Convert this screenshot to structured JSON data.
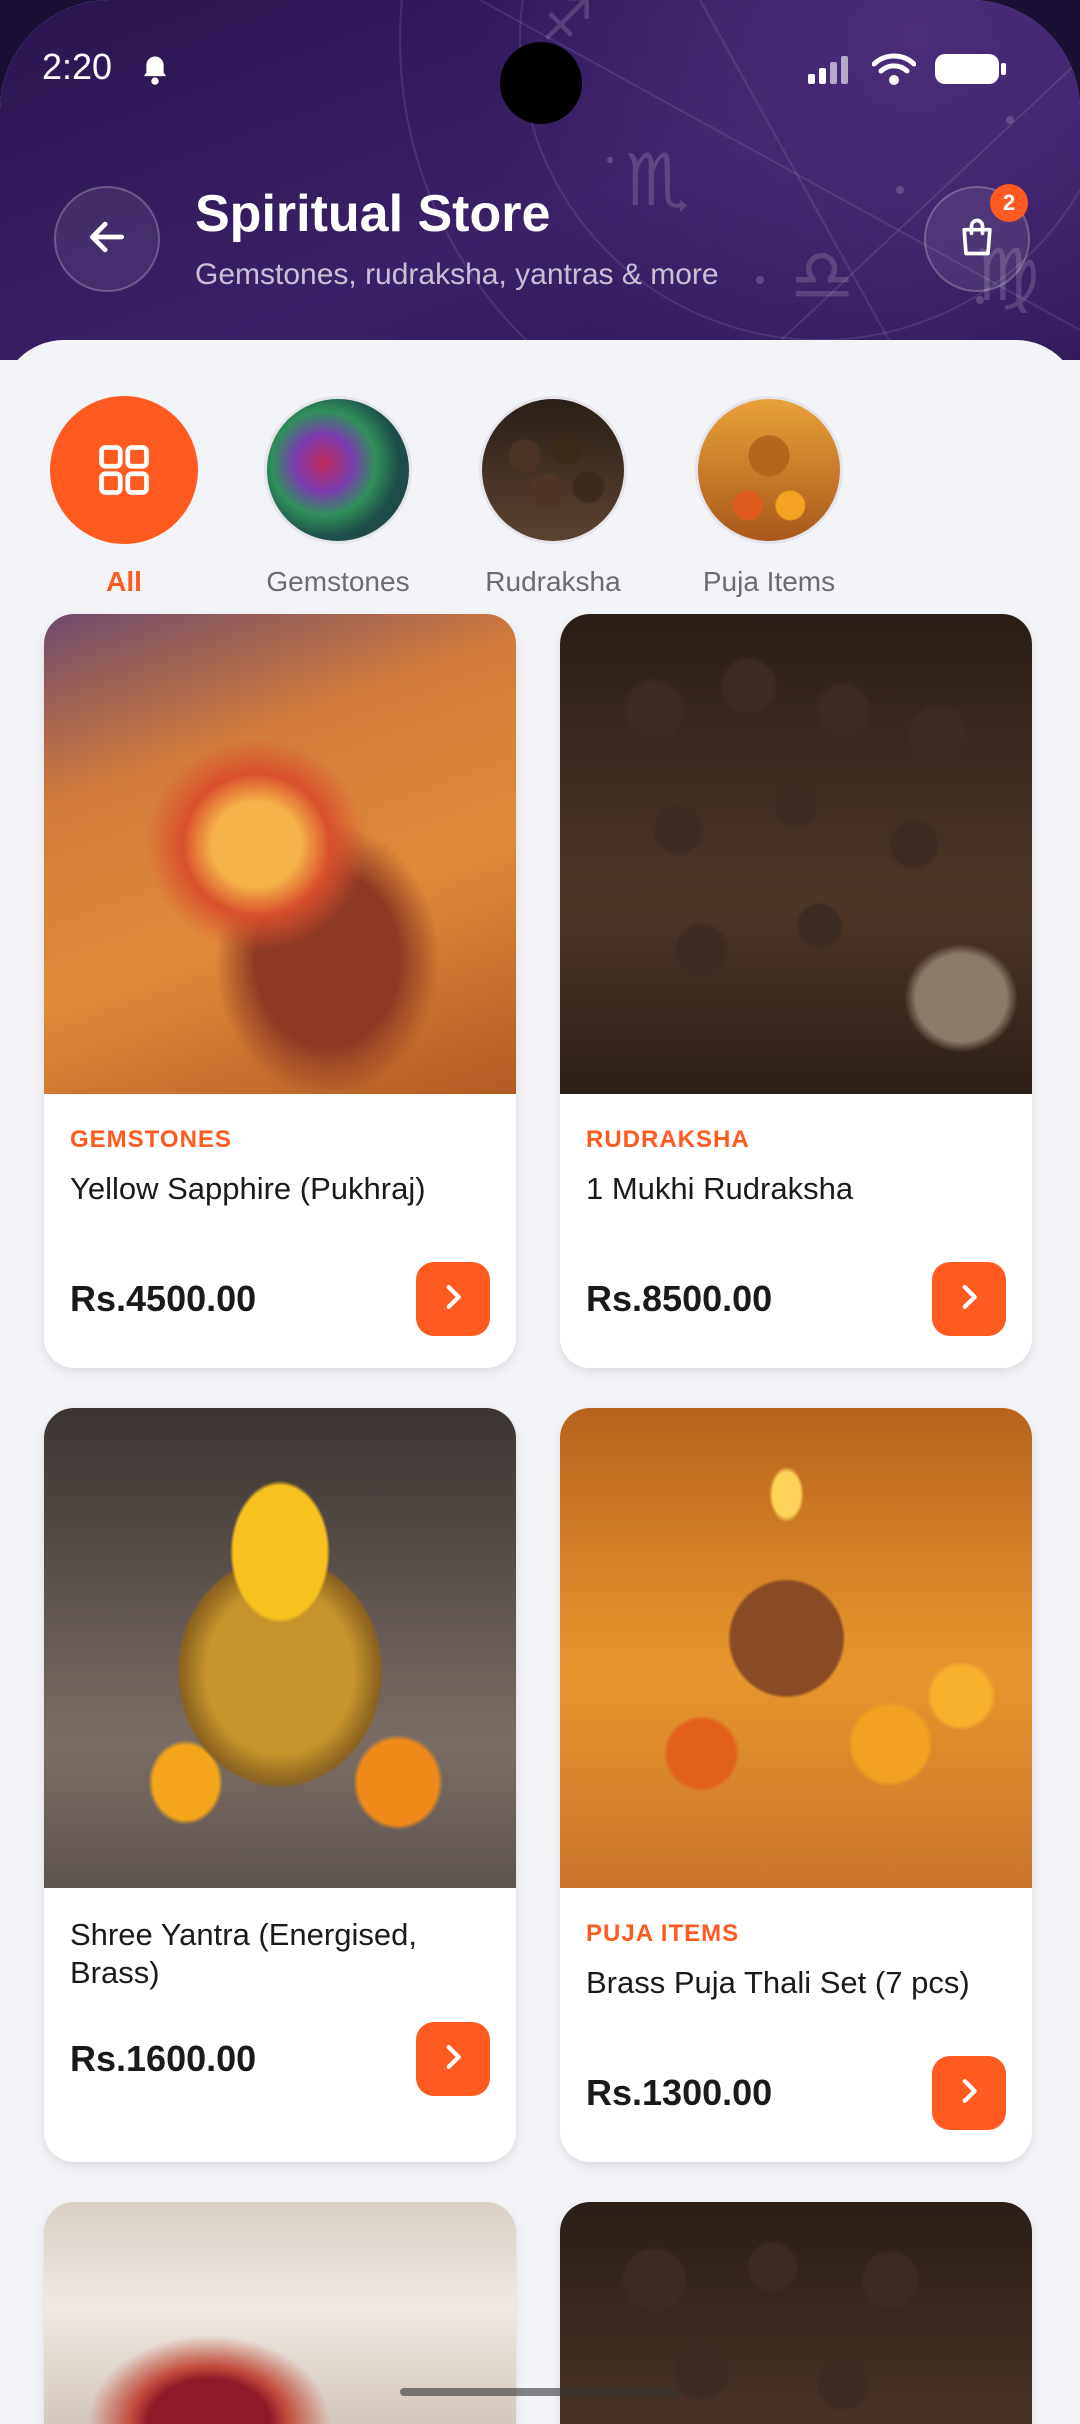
{
  "status_bar": {
    "time": "2:20"
  },
  "header": {
    "title": "Spiritual Store",
    "subtitle": "Gemstones, rudraksha, yantras & more",
    "cart_count": "2"
  },
  "categories": [
    {
      "label": "All",
      "icon": "grid-icon",
      "active": true
    },
    {
      "label": "Gemstones",
      "icon": "gemstone-thumbnail"
    },
    {
      "label": "Rudraksha",
      "icon": "rudraksha-thumbnail"
    },
    {
      "label": "Puja Items",
      "icon": "puja-items-thumbnail"
    }
  ],
  "products": [
    {
      "category": "GEMSTONES",
      "name": "Yellow Sapphire (Pukhraj)",
      "price": "Rs.4500.00"
    },
    {
      "category": "RUDRAKSHA",
      "name": "1 Mukhi Rudraksha",
      "price": "Rs.8500.00"
    },
    {
      "category": "",
      "name": "Shree Yantra (Energised, Brass)",
      "price": "Rs.1600.00"
    },
    {
      "category": "PUJA ITEMS",
      "name": "Brass Puja Thali Set (7 pcs)",
      "price": "Rs.1300.00"
    }
  ],
  "colors": {
    "accent": "#ff5a1f",
    "header_bg": "#2d1755"
  }
}
